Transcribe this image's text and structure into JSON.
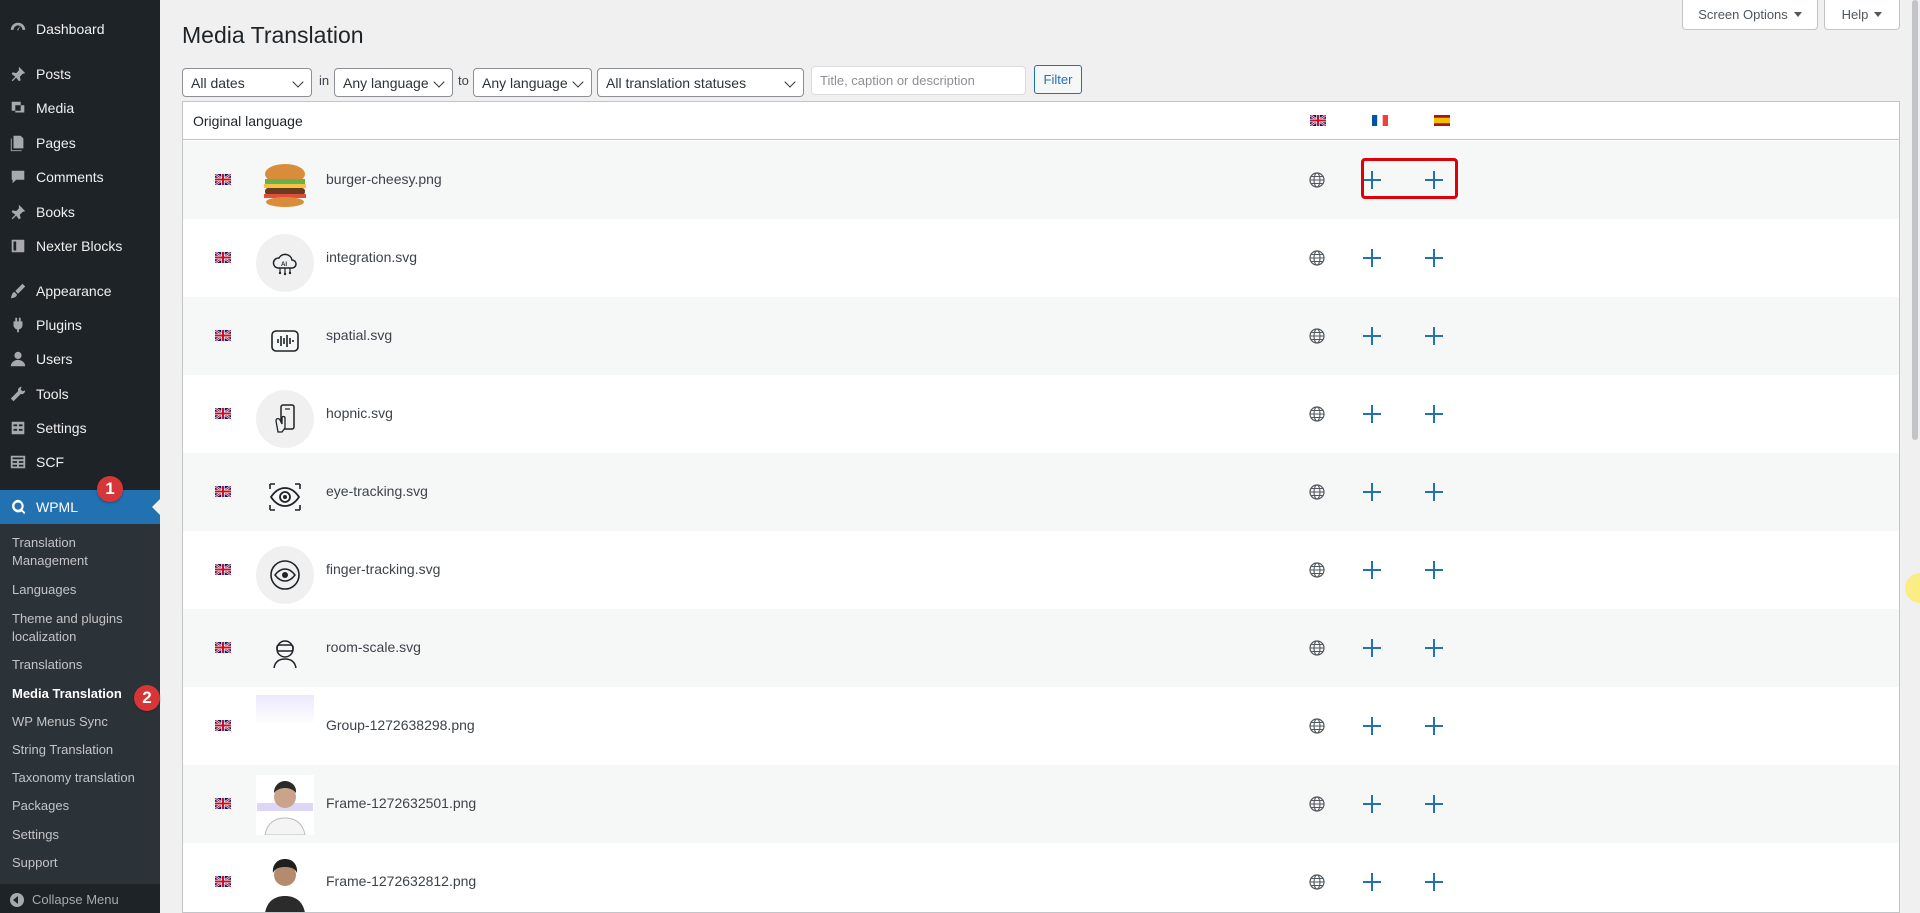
{
  "sidebar": {
    "items": [
      {
        "label": "Dashboard",
        "icon": "dashboard-icon"
      },
      {
        "label": "Posts",
        "icon": "pushpin-icon"
      },
      {
        "label": "Media",
        "icon": "media-icon"
      },
      {
        "label": "Pages",
        "icon": "pages-icon"
      },
      {
        "label": "Comments",
        "icon": "comments-icon"
      },
      {
        "label": "Books",
        "icon": "pushpin-icon"
      },
      {
        "label": "Nexter Blocks",
        "icon": "blocks-icon"
      },
      {
        "label": "Appearance",
        "icon": "brush-icon"
      },
      {
        "label": "Plugins",
        "icon": "plugin-icon"
      },
      {
        "label": "Users",
        "icon": "users-icon"
      },
      {
        "label": "Tools",
        "icon": "wrench-icon"
      },
      {
        "label": "Settings",
        "icon": "settings-icon"
      },
      {
        "label": "SCF",
        "icon": "table-icon"
      },
      {
        "label": "WPML",
        "icon": "wpml-icon"
      }
    ],
    "submenu": [
      "Translation Management",
      "Languages",
      "Theme and plugins localization",
      "Translations",
      "Media Translation",
      "WP Menus Sync",
      "String Translation",
      "Taxonomy translation",
      "Packages",
      "Settings",
      "Support"
    ],
    "collapse_label": "Collapse Menu",
    "badges": [
      "1",
      "2"
    ]
  },
  "header": {
    "title": "Media Translation",
    "screen_options": "Screen Options",
    "help": "Help"
  },
  "filters": {
    "dates": "All dates",
    "in_label": "in",
    "from_language": "Any language",
    "to_label": "to",
    "to_language": "Any language",
    "status": "All translation statuses",
    "search_placeholder": "Title, caption or description",
    "filter_button": "Filter"
  },
  "table": {
    "header_label": "Original language",
    "languages": [
      "en",
      "fr",
      "es"
    ],
    "rows": [
      {
        "file": "burger-cheesy.png"
      },
      {
        "file": "integration.svg"
      },
      {
        "file": "spatial.svg"
      },
      {
        "file": "hopnic.svg"
      },
      {
        "file": "eye-tracking.svg"
      },
      {
        "file": "finger-tracking.svg"
      },
      {
        "file": "room-scale.svg"
      },
      {
        "file": "Group-1272638298.png"
      },
      {
        "file": "Frame-1272632501.png"
      },
      {
        "file": "Frame-1272632812.png"
      }
    ]
  },
  "colors": {
    "sidebar_bg": "#1d2327",
    "accent": "#2271b1",
    "highlight": "#e0000a",
    "badge": "#d63638"
  }
}
